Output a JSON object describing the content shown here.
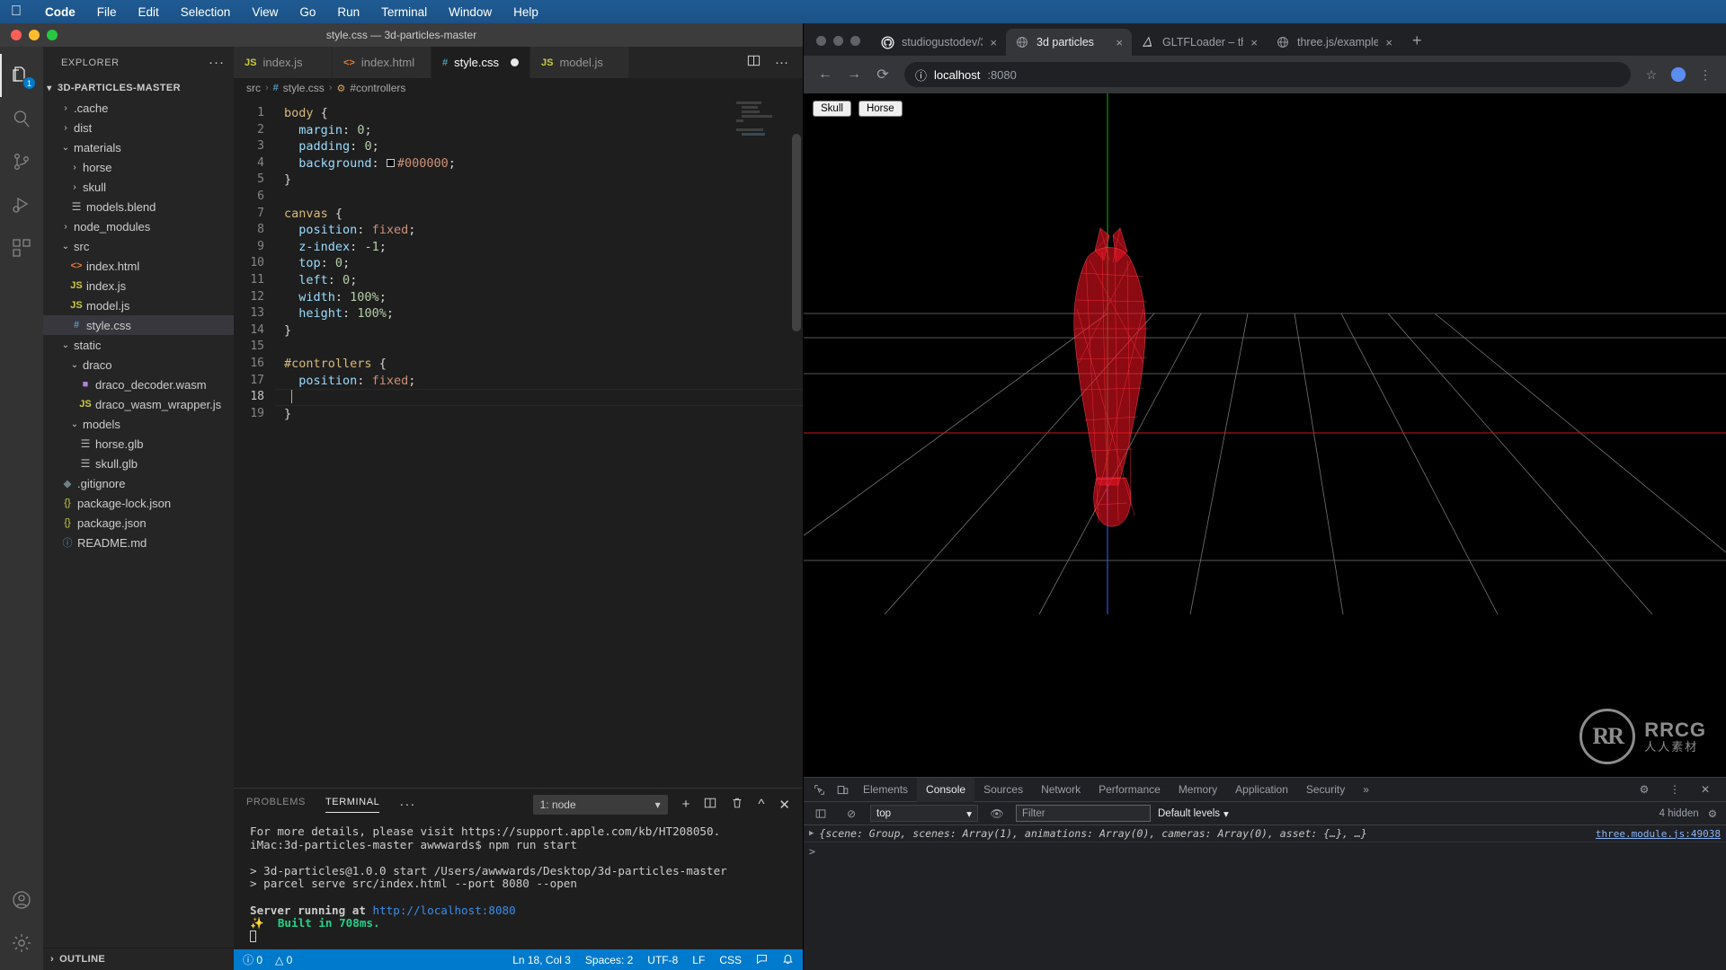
{
  "macos_menu": {
    "apple_icon": "apple-icon",
    "items": [
      {
        "label": "Code",
        "bold": true
      },
      {
        "label": "File",
        "bold": false
      },
      {
        "label": "Edit",
        "bold": false
      },
      {
        "label": "Selection",
        "bold": false
      },
      {
        "label": "View",
        "bold": false
      },
      {
        "label": "Go",
        "bold": false
      },
      {
        "label": "Run",
        "bold": false
      },
      {
        "label": "Terminal",
        "bold": false
      },
      {
        "label": "Window",
        "bold": false
      },
      {
        "label": "Help",
        "bold": false
      }
    ]
  },
  "vscode": {
    "window_title": "style.css — 3d-particles-master",
    "activity_bar": {
      "explorer_badge": "1",
      "items": [
        "files-icon",
        "search-icon",
        "source-control-icon",
        "run-debug-icon",
        "extensions-icon"
      ],
      "bottom_items": [
        "account-icon",
        "settings-gear-icon"
      ]
    },
    "explorer": {
      "title": "EXPLORER",
      "more_actions": "···",
      "root": "3D-PARTICLES-MASTER",
      "outline_label": "OUTLINE",
      "tree": [
        {
          "label": ".cache",
          "type": "folder",
          "depth": 1,
          "expanded": false
        },
        {
          "label": "dist",
          "type": "folder",
          "depth": 1,
          "expanded": false
        },
        {
          "label": "materials",
          "type": "folder",
          "depth": 1,
          "expanded": true
        },
        {
          "label": "horse",
          "type": "folder",
          "depth": 2,
          "expanded": false
        },
        {
          "label": "skull",
          "type": "folder",
          "depth": 2,
          "expanded": false
        },
        {
          "label": "models.blend",
          "type": "file",
          "depth": 2
        },
        {
          "label": "node_modules",
          "type": "folder",
          "depth": 1,
          "expanded": false
        },
        {
          "label": "src",
          "type": "folder",
          "depth": 1,
          "expanded": true
        },
        {
          "label": "index.html",
          "type": "html",
          "depth": 2
        },
        {
          "label": "index.js",
          "type": "js",
          "depth": 2
        },
        {
          "label": "model.js",
          "type": "js",
          "depth": 2
        },
        {
          "label": "style.css",
          "type": "css",
          "depth": 2,
          "selected": true
        },
        {
          "label": "static",
          "type": "folder",
          "depth": 1,
          "expanded": true
        },
        {
          "label": "draco",
          "type": "folder",
          "depth": 2,
          "expanded": true
        },
        {
          "label": "draco_decoder.wasm",
          "type": "wasm",
          "depth": 3
        },
        {
          "label": "draco_wasm_wrapper.js",
          "type": "js",
          "depth": 3
        },
        {
          "label": "models",
          "type": "folder",
          "depth": 2,
          "expanded": true
        },
        {
          "label": "horse.glb",
          "type": "file",
          "depth": 3
        },
        {
          "label": "skull.glb",
          "type": "file",
          "depth": 3
        },
        {
          "label": ".gitignore",
          "type": "git",
          "depth": 1
        },
        {
          "label": "package-lock.json",
          "type": "json",
          "depth": 1
        },
        {
          "label": "package.json",
          "type": "json",
          "depth": 1
        },
        {
          "label": "README.md",
          "type": "md",
          "depth": 1
        }
      ]
    },
    "tabs": [
      {
        "label": "index.js",
        "type": "js",
        "active": false,
        "dirty": false
      },
      {
        "label": "index.html",
        "type": "html",
        "active": false,
        "dirty": false
      },
      {
        "label": "style.css",
        "type": "css",
        "active": true,
        "dirty": true
      },
      {
        "label": "model.js",
        "type": "js",
        "active": false,
        "dirty": false
      }
    ],
    "tab_actions": [
      "split-editor-icon",
      "more-actions-icon"
    ],
    "breadcrumb": [
      "src",
      "style.css",
      "#controllers"
    ],
    "code_lines": [
      {
        "n": 1,
        "text": "body {"
      },
      {
        "n": 2,
        "text": "  margin: 0;"
      },
      {
        "n": 3,
        "text": "  padding: 0;"
      },
      {
        "n": 4,
        "text": "  background: #000000;"
      },
      {
        "n": 5,
        "text": "}"
      },
      {
        "n": 6,
        "text": ""
      },
      {
        "n": 7,
        "text": "canvas {"
      },
      {
        "n": 8,
        "text": "  position: fixed;"
      },
      {
        "n": 9,
        "text": "  z-index: -1;"
      },
      {
        "n": 10,
        "text": "  top: 0;"
      },
      {
        "n": 11,
        "text": "  left: 0;"
      },
      {
        "n": 12,
        "text": "  width: 100%;"
      },
      {
        "n": 13,
        "text": "  height: 100%;"
      },
      {
        "n": 14,
        "text": "}"
      },
      {
        "n": 15,
        "text": ""
      },
      {
        "n": 16,
        "text": "#controllers {"
      },
      {
        "n": 17,
        "text": "  position: fixed;"
      },
      {
        "n": 18,
        "text": "  "
      },
      {
        "n": 19,
        "text": "}"
      }
    ],
    "panel": {
      "tabs": [
        "PROBLEMS",
        "TERMINAL"
      ],
      "active_tab": "TERMINAL",
      "more": "···",
      "terminal_select": "1: node",
      "actions": [
        "new-terminal-icon",
        "split-terminal-icon",
        "kill-terminal-icon",
        "chevron-up-icon",
        "close-panel-icon"
      ],
      "output": [
        {
          "segments": [
            {
              "t": "For more details, please visit https://support.apple.com/kb/HT208050.",
              "c": "plain"
            }
          ]
        },
        {
          "segments": [
            {
              "t": "iMac:3d-particles-master awwwards$ npm run start",
              "c": "plain"
            }
          ]
        },
        {
          "segments": [
            {
              "t": "",
              "c": "plain"
            }
          ]
        },
        {
          "segments": [
            {
              "t": "> 3d-particles@1.0.0 start /Users/awwwards/Desktop/3d-particles-master",
              "c": "plain"
            }
          ]
        },
        {
          "segments": [
            {
              "t": "> parcel serve src/index.html --port 8080 --open",
              "c": "plain"
            }
          ]
        },
        {
          "segments": [
            {
              "t": "",
              "c": "plain"
            }
          ]
        },
        {
          "segments": [
            {
              "t": "Server running at ",
              "c": "bold"
            },
            {
              "t": "http://localhost:8080",
              "c": "link"
            }
          ]
        },
        {
          "segments": [
            {
              "t": "✨  Built in 708ms.",
              "c": "green"
            }
          ]
        }
      ]
    },
    "status_bar": {
      "errors": "0",
      "warnings": "0",
      "cursor": "Ln 18, Col 3",
      "spaces": "Spaces: 2",
      "encoding": "UTF-8",
      "eol": "LF",
      "language": "CSS",
      "right_icons": [
        "feedback-icon",
        "bell-icon"
      ]
    }
  },
  "chrome": {
    "tabs": [
      {
        "label": "studiogustodev/3",
        "favicon": "github-icon",
        "active": false,
        "close": "×"
      },
      {
        "label": "3d particles",
        "favicon": "globe-icon",
        "active": true,
        "close": "×"
      },
      {
        "label": "GLTFLoader – th",
        "favicon": "threejs-icon",
        "active": false,
        "close": "×"
      },
      {
        "label": "three.js/example",
        "favicon": "globe-icon",
        "active": false,
        "close": "×"
      }
    ],
    "new_tab": "+",
    "toolbar": {
      "back_icon": "back-arrow-icon",
      "forward_icon": "forward-arrow-icon",
      "reload_icon": "reload-icon",
      "info_icon": "page-info-icon",
      "url_host": "localhost",
      "url_rest": ":8080",
      "star_icon": "bookmark-star-icon",
      "profile_icon": "profile-avatar-icon",
      "menu_icon": "three-dot-menu-icon"
    },
    "page": {
      "buttons": [
        "Skull",
        "Horse"
      ],
      "canvas_description": "red wireframe horse head over 3d grid"
    },
    "watermark": {
      "logo": "RR",
      "big": "RRCG",
      "small": "人人素材"
    },
    "devtools": {
      "left_icons": [
        "inspect-element-icon",
        "device-toolbar-icon"
      ],
      "tabs": [
        "Elements",
        "Console",
        "Sources",
        "Network",
        "Performance",
        "Memory",
        "Application",
        "Security"
      ],
      "active_tab": "Console",
      "overflow": "»",
      "right_icons": [
        "settings-gear-icon",
        "devtools-more-icon",
        "devtools-close-icon"
      ],
      "toolbar": {
        "sidebar_icon": "console-sidebar-icon",
        "clear_icon": "clear-console-icon",
        "context": "top",
        "eye_icon": "live-expression-icon",
        "filter_placeholder": "Filter",
        "levels": "Default levels",
        "hidden_count": "4 hidden",
        "settings_icon": "console-settings-icon"
      },
      "console_rows": [
        {
          "arrow": "▶",
          "text": "{scene: Group, scenes: Array(1), animations: Array(0), cameras: Array(0), asset: {…}, …}",
          "source": "three.module.js:49038"
        }
      ],
      "prompt": ">"
    }
  }
}
